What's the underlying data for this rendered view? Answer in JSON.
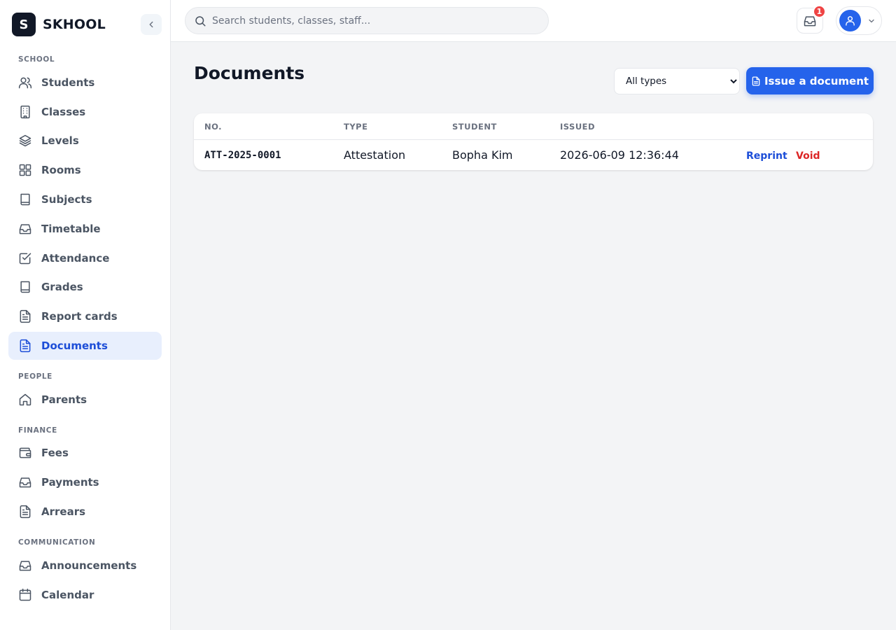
{
  "app": {
    "logo_letter": "S",
    "name": "SKHOOL"
  },
  "sidebar": {
    "sections": [
      {
        "label": "SCHOOL"
      },
      {
        "label": "PEOPLE"
      },
      {
        "label": "FINANCE"
      },
      {
        "label": "COMMUNICATION"
      }
    ],
    "items": [
      {
        "label": "Students",
        "icon": "users-icon"
      },
      {
        "label": "Classes",
        "icon": "building-icon"
      },
      {
        "label": "Levels",
        "icon": "layers-icon"
      },
      {
        "label": "Rooms",
        "icon": "grid-icon"
      },
      {
        "label": "Subjects",
        "icon": "book-icon"
      },
      {
        "label": "Timetable",
        "icon": "inbox-icon"
      },
      {
        "label": "Attendance",
        "icon": "check-square-icon"
      },
      {
        "label": "Grades",
        "icon": "book-icon"
      },
      {
        "label": "Report cards",
        "icon": "file-text-icon"
      },
      {
        "label": "Documents",
        "icon": "file-text-icon",
        "active": true
      },
      {
        "label": "Parents",
        "icon": "home-icon"
      },
      {
        "label": "Fees",
        "icon": "wallet-icon"
      },
      {
        "label": "Payments",
        "icon": "inbox-icon"
      },
      {
        "label": "Arrears",
        "icon": "file-text-icon"
      },
      {
        "label": "Announcements",
        "icon": "inbox-icon"
      },
      {
        "label": "Calendar",
        "icon": "calendar-icon"
      }
    ]
  },
  "topbar": {
    "search_placeholder": "Search students, classes, staff...",
    "notification_count": "1"
  },
  "main": {
    "title": "Documents",
    "filter": {
      "selected": "All types"
    },
    "issue_button_label": "Issue a document",
    "table": {
      "headers": [
        "NO.",
        "TYPE",
        "STUDENT",
        "ISSUED"
      ],
      "rows": [
        {
          "no": "ATT-2025-0001",
          "type": "Attestation",
          "student": "Bopha Kim",
          "issued": "2026-06-09 12:36:44",
          "actions": [
            "Reprint",
            "Void"
          ]
        }
      ]
    }
  },
  "colors": {
    "accent": "#2563eb",
    "active_bg": "#e8effd",
    "danger": "#dc2626"
  }
}
